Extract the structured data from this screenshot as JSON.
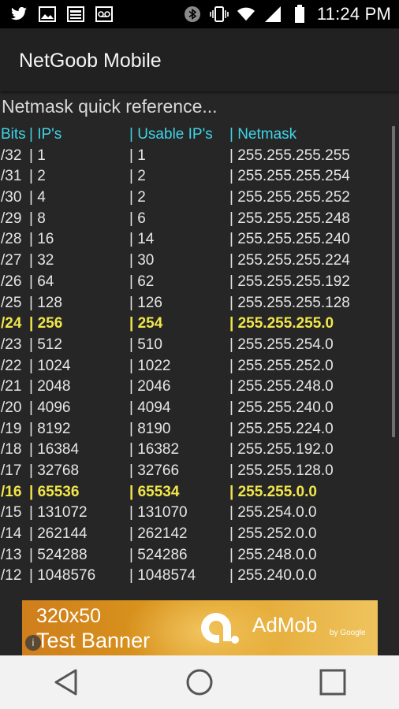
{
  "status_bar": {
    "time": "11:24 PM",
    "icons_left": [
      "twitter-icon",
      "image-icon",
      "news-icon",
      "voicemail-icon"
    ],
    "icons_right": [
      "bluetooth-icon",
      "vibrate-icon",
      "wifi-icon",
      "signal-icon",
      "battery-icon"
    ]
  },
  "app_bar": {
    "title": "NetGoob Mobile"
  },
  "content": {
    "subtitle": "Netmask quick reference...",
    "headers": {
      "bits": "Bits",
      "ips": "| IP's",
      "usable": "| Usable IP's",
      "mask": "| Netmask"
    },
    "rows": [
      {
        "bits": "/32",
        "ips": "| 1",
        "usable": "| 1",
        "mask": "| 255.255.255.255",
        "highlight": false
      },
      {
        "bits": "/31",
        "ips": "| 2",
        "usable": "| 2",
        "mask": "| 255.255.255.254",
        "highlight": false
      },
      {
        "bits": "/30",
        "ips": "| 4",
        "usable": "| 2",
        "mask": "| 255.255.255.252",
        "highlight": false
      },
      {
        "bits": "/29",
        "ips": "| 8",
        "usable": "| 6",
        "mask": "| 255.255.255.248",
        "highlight": false
      },
      {
        "bits": "/28",
        "ips": "| 16",
        "usable": "| 14",
        "mask": "| 255.255.255.240",
        "highlight": false
      },
      {
        "bits": "/27",
        "ips": "| 32",
        "usable": "| 30",
        "mask": "| 255.255.255.224",
        "highlight": false
      },
      {
        "bits": "/26",
        "ips": "| 64",
        "usable": "| 62",
        "mask": "| 255.255.255.192",
        "highlight": false
      },
      {
        "bits": "/25",
        "ips": "| 128",
        "usable": "| 126",
        "mask": "| 255.255.255.128",
        "highlight": false
      },
      {
        "bits": "/24",
        "ips": "| 256",
        "usable": "| 254",
        "mask": "| 255.255.255.0",
        "highlight": true
      },
      {
        "bits": "/23",
        "ips": "| 512",
        "usable": "| 510",
        "mask": "| 255.255.254.0",
        "highlight": false
      },
      {
        "bits": "/22",
        "ips": "| 1024",
        "usable": "| 1022",
        "mask": "| 255.255.252.0",
        "highlight": false
      },
      {
        "bits": "/21",
        "ips": "| 2048",
        "usable": "| 2046",
        "mask": "| 255.255.248.0",
        "highlight": false
      },
      {
        "bits": "/20",
        "ips": "| 4096",
        "usable": "| 4094",
        "mask": "| 255.255.240.0",
        "highlight": false
      },
      {
        "bits": "/19",
        "ips": "| 8192",
        "usable": "| 8190",
        "mask": "| 255.255.224.0",
        "highlight": false
      },
      {
        "bits": "/18",
        "ips": "| 16384",
        "usable": "| 16382",
        "mask": "| 255.255.192.0",
        "highlight": false
      },
      {
        "bits": "/17",
        "ips": "| 32768",
        "usable": "| 32766",
        "mask": "| 255.255.128.0",
        "highlight": false
      },
      {
        "bits": "/16",
        "ips": "| 65536",
        "usable": "| 65534",
        "mask": "| 255.255.0.0",
        "highlight": true
      },
      {
        "bits": "/15",
        "ips": "| 131072",
        "usable": "| 131070",
        "mask": "| 255.254.0.0",
        "highlight": false
      },
      {
        "bits": "/14",
        "ips": "| 262144",
        "usable": "| 262142",
        "mask": "| 255.252.0.0",
        "highlight": false
      },
      {
        "bits": "/13",
        "ips": "| 524288",
        "usable": "| 524286",
        "mask": "| 255.248.0.0",
        "highlight": false
      },
      {
        "bits": "/12",
        "ips": "| 1048576",
        "usable": "| 1048574",
        "mask": "| 255.240.0.0",
        "highlight": false
      }
    ]
  },
  "ad_banner": {
    "size_label": "320x50",
    "label": "Test Banner",
    "brand": "AdMob",
    "brand_sub": "by Google",
    "info_glyph": "i"
  },
  "nav_bar": {
    "buttons": [
      "back-icon",
      "home-icon",
      "recents-icon"
    ]
  },
  "colors": {
    "background": "#262626",
    "app_bar": "#212121",
    "header_text": "#3fd4e6",
    "highlight_text": "#f1e64b",
    "body_text": "#e6e6e6"
  }
}
